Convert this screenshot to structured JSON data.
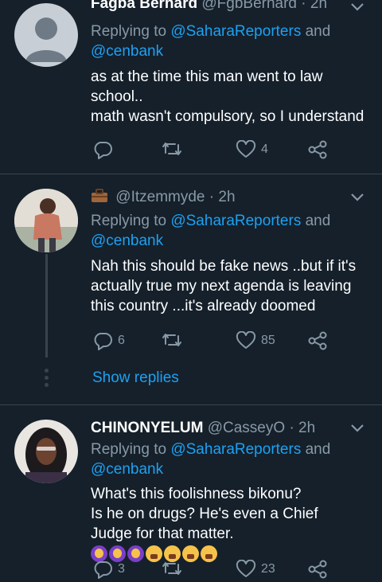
{
  "tweets": [
    {
      "name": "Fagba Bernard",
      "handle": "@FgbBernard",
      "time": "2h",
      "replying_prefix": "Replying to ",
      "mention1": "@SaharaReporters",
      "and": " and",
      "mention2": "@cenbank",
      "text_lines": [
        "as at the time this man went to law school..",
        "math wasn't compulsory, so I understand"
      ],
      "reply_count": "",
      "retweet_count": "",
      "like_count": "4"
    },
    {
      "name": "",
      "handle": "@Itzemmyde",
      "time": "2h",
      "replying_prefix": "Replying to ",
      "mention1": "@SaharaReporters",
      "and": " and",
      "mention2": "@cenbank",
      "text_lines": [
        "Nah this should be fake news ..but if it's actually true my next agenda is leaving this country ...it's already doomed"
      ],
      "reply_count": "6",
      "retweet_count": "",
      "like_count": "85",
      "show_replies": "Show replies"
    },
    {
      "name": "CHINONYELUM",
      "handle": "@CasseyO",
      "time": "2h",
      "replying_prefix": "Replying to ",
      "mention1": "@SaharaReporters",
      "and": " and",
      "mention2": "@cenbank",
      "text_lines": [
        "What's this foolishness bikonu?",
        "Is he on drugs? He's even a Chief Judge for that matter."
      ],
      "reply_count": "3",
      "retweet_count": "",
      "like_count": "23"
    }
  ],
  "icons": {
    "reply": "reply-icon",
    "retweet": "retweet-icon",
    "like": "heart-icon",
    "share": "share-icon",
    "more": "chevron-down-icon",
    "briefcase": "briefcase-icon"
  },
  "colors": {
    "background": "#15202b",
    "accent": "#1da1f2",
    "muted": "#8899a6",
    "divider": "#38444d"
  }
}
